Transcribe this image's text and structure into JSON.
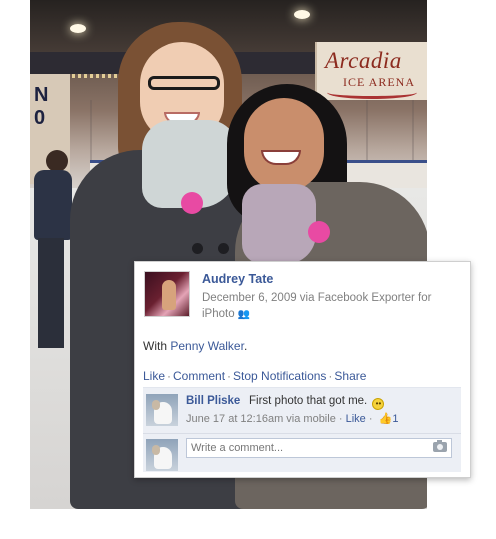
{
  "photo": {
    "sign_name": "Arcadia",
    "sign_sub": "ICE ARENA",
    "wall_mark": "N\n0"
  },
  "post": {
    "author": "Audrey Tate",
    "date": "December 6, 2009 via Facebook Exporter for iPhoto",
    "privacy_icon": "friends-icon",
    "with_prefix": "With",
    "with_person": "Penny Walker",
    "with_suffix": ".",
    "actions": {
      "like": "Like",
      "comment": "Comment",
      "stop_notifications": "Stop Notifications",
      "share": "Share",
      "separator": "·"
    }
  },
  "comment": {
    "author": "Bill Pliske",
    "text": "First photo that got me.",
    "emoticon": "smiley-icon",
    "time": "June 17 at 12:16am via mobile",
    "separator": "·",
    "like_label": "Like",
    "like_count": "1"
  },
  "composer": {
    "placeholder": "Write a comment..."
  },
  "colors": {
    "link": "#3b5998",
    "comment_bg": "#eceff5",
    "meta_text": "#808080"
  }
}
